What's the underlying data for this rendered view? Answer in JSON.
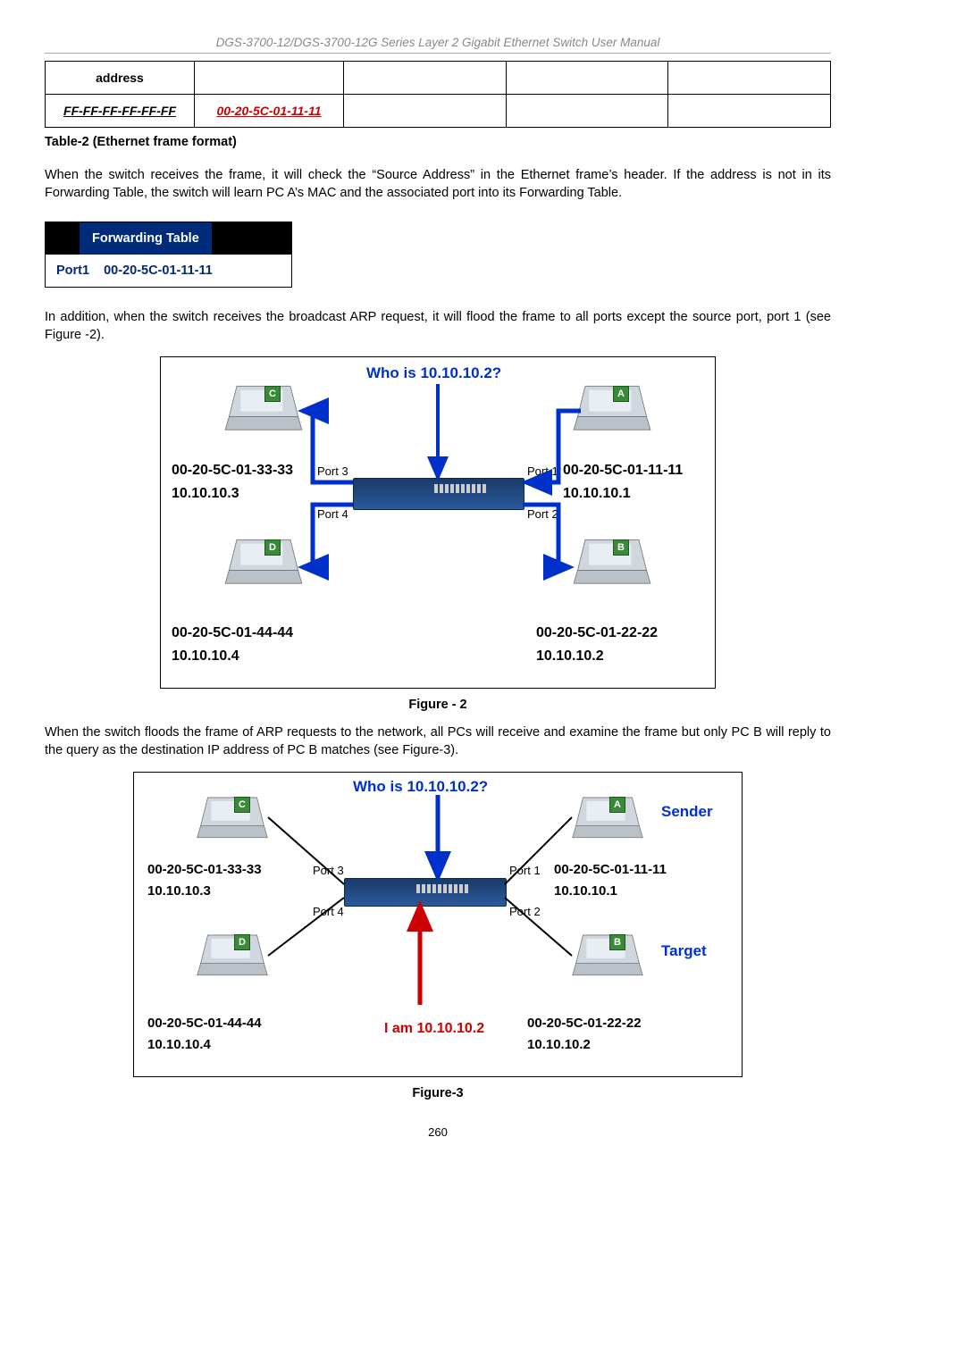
{
  "header": "DGS-3700-12/DGS-3700-12G Series Layer 2 Gigabit Ethernet Switch User Manual",
  "frame_table": {
    "row1": {
      "c1": "address",
      "c2": "",
      "c3": "",
      "c4": "",
      "c5": ""
    },
    "row2": {
      "c1": "FF-FF-FF-FF-FF-FF",
      "c2": "00-20-5C-01-11-11",
      "c3": "",
      "c4": "",
      "c5": ""
    }
  },
  "table_caption": "Table-2 (Ethernet frame format)",
  "para1": "When the switch receives the frame, it will check the “Source Address” in the Ethernet frame’s header. If the address is not in its Forwarding Table, the switch will learn PC A’s MAC and the associated port into its Forwarding Table.",
  "fwd": {
    "title": "Forwarding Table",
    "port": "Port1",
    "mac": "00-20-5C-01-11-11"
  },
  "para2": "In addition, when the switch receives the broadcast ARP request, it will flood the frame to all ports except the source port, port 1 (see Figure -2).",
  "fig2_caption": "Figure - 2",
  "para3": "When the switch floods the frame of ARP requests to the network, all PCs will receive and examine the frame but only PC B will reply to the query as the destination IP address of PC B matches (see Figure-3).",
  "fig3_caption": "Figure-3",
  "page_number": "260",
  "diagram_common": {
    "query": "Who is 10.10.10.2?",
    "reply": "I am 10.10.10.2",
    "sender": "Sender",
    "target": "Target",
    "ports": {
      "p1": "Port 1",
      "p2": "Port 2",
      "p3": "Port 3",
      "p4": "Port 4"
    },
    "hosts": {
      "A": {
        "tag": "A",
        "mac": "00-20-5C-01-11-11",
        "ip": "10.10.10.1"
      },
      "B": {
        "tag": "B",
        "mac": "00-20-5C-01-22-22",
        "ip": "10.10.10.2"
      },
      "C": {
        "tag": "C",
        "mac": "00-20-5C-01-33-33",
        "ip": "10.10.10.3"
      },
      "D": {
        "tag": "D",
        "mac": "00-20-5C-01-44-44",
        "ip": "10.10.10.4"
      }
    }
  }
}
